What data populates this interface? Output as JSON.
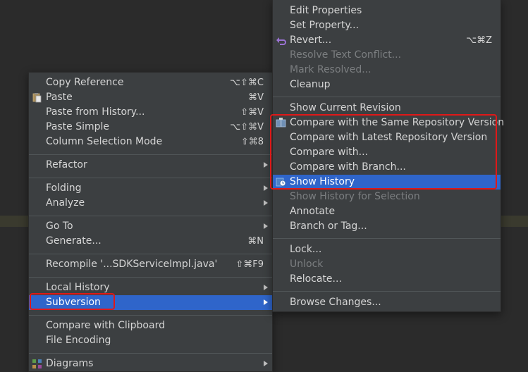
{
  "left_menu": {
    "items": [
      {
        "label": "Copy Reference",
        "shortcut": "⌥⇧⌘C"
      },
      {
        "label": "Paste",
        "shortcut": "⌘V"
      },
      {
        "label": "Paste from History...",
        "shortcut": "⇧⌘V"
      },
      {
        "label": "Paste Simple",
        "shortcut": "⌥⇧⌘V"
      },
      {
        "label": "Column Selection Mode",
        "shortcut": "⇧⌘8"
      },
      {
        "label": "Refactor"
      },
      {
        "label": "Folding"
      },
      {
        "label": "Analyze"
      },
      {
        "label": "Go To"
      },
      {
        "label": "Generate...",
        "shortcut": "⌘N"
      },
      {
        "label": "Recompile '...SDKServiceImpl.java'",
        "shortcut": "⇧⌘F9"
      },
      {
        "label": "Local History"
      },
      {
        "label": "Subversion"
      },
      {
        "label": "Compare with Clipboard"
      },
      {
        "label": "File Encoding"
      },
      {
        "label": "Diagrams"
      }
    ]
  },
  "right_menu": {
    "items": [
      {
        "label": "Edit Properties"
      },
      {
        "label": "Set Property..."
      },
      {
        "label": "Revert...",
        "shortcut": "⌥⌘Z"
      },
      {
        "label": "Resolve Text Conflict..."
      },
      {
        "label": "Mark Resolved..."
      },
      {
        "label": "Cleanup"
      },
      {
        "label": "Show Current Revision"
      },
      {
        "label": "Compare with the Same Repository Version"
      },
      {
        "label": "Compare with Latest Repository Version"
      },
      {
        "label": "Compare with..."
      },
      {
        "label": "Compare with Branch..."
      },
      {
        "label": "Show History"
      },
      {
        "label": "Show History for Selection"
      },
      {
        "label": "Annotate"
      },
      {
        "label": "Branch or Tag..."
      },
      {
        "label": "Lock..."
      },
      {
        "label": "Unlock"
      },
      {
        "label": "Relocate..."
      },
      {
        "label": "Browse Changes..."
      }
    ]
  },
  "colors": {
    "menu_bg": "#3c3f41",
    "selection": "#2f65ca",
    "annotation_red": "#e01818",
    "disabled_text": "#7b7e80"
  }
}
